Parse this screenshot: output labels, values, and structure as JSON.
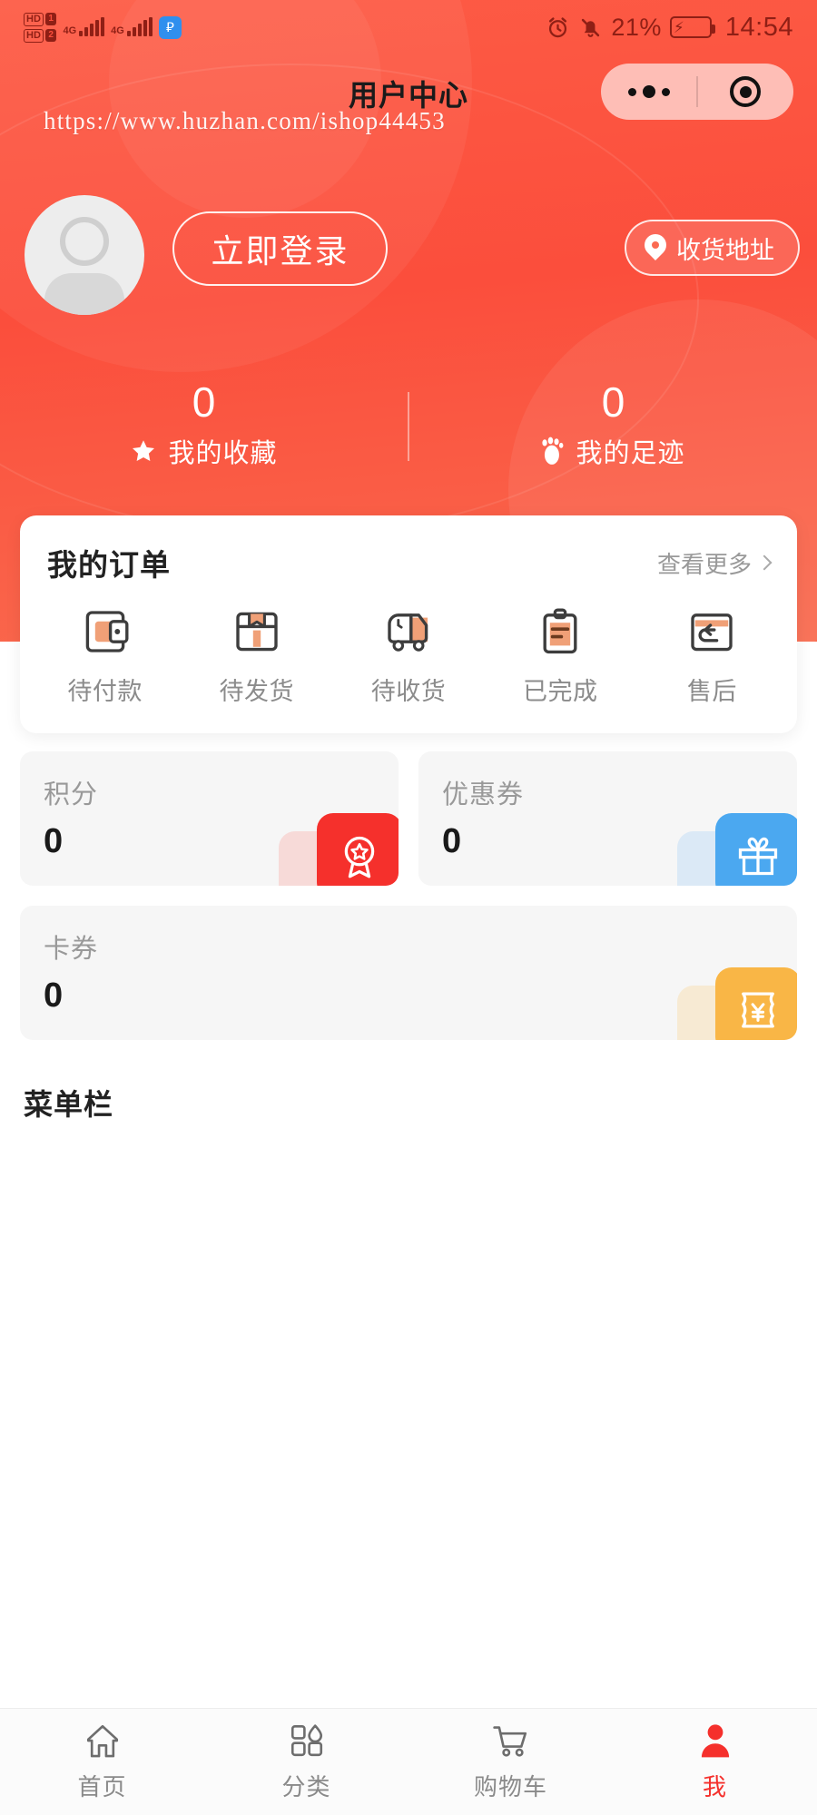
{
  "status_bar": {
    "hd1": "HD",
    "hd1_num": "1",
    "hd2": "HD",
    "hd2_num": "2",
    "net1": "4G",
    "net2": "4G",
    "bluetooth_icon": "bluetooth-icon",
    "alarm_icon": "alarm-icon",
    "mute_icon": "bell-muted-icon",
    "battery_percent": "21%",
    "battery_icon": "battery-charging-icon",
    "time": "14:54"
  },
  "navbar": {
    "title": "用户中心",
    "capsule": {
      "menu_icon": "more-dots-icon",
      "target_icon": "target-circle-icon"
    }
  },
  "watermark": "https://www.huzhan.com/ishop44453",
  "profile": {
    "avatar_icon": "default-avatar-icon",
    "login_label": "立即登录",
    "address_label": "收货地址",
    "address_icon": "location-pin-icon"
  },
  "stats": [
    {
      "value": "0",
      "label": "我的收藏",
      "icon": "star-icon"
    },
    {
      "value": "0",
      "label": "我的足迹",
      "icon": "footprint-icon"
    }
  ],
  "orders": {
    "title": "我的订单",
    "more_label": "查看更多",
    "more_icon": "chevron-right-icon",
    "items": [
      {
        "label": "待付款",
        "icon": "wallet-icon"
      },
      {
        "label": "待发货",
        "icon": "package-icon"
      },
      {
        "label": "待收货",
        "icon": "truck-icon"
      },
      {
        "label": "已完成",
        "icon": "clipboard-icon"
      },
      {
        "label": "售后",
        "icon": "return-icon"
      }
    ]
  },
  "assets": [
    {
      "title": "积分",
      "value": "0",
      "icon": "medal-icon",
      "color": "#F5302C",
      "ghost": "#FBAEA9"
    },
    {
      "title": "优惠券",
      "value": "0",
      "icon": "gift-icon",
      "color": "#4BA8F0",
      "ghost": "#AFD6F7"
    },
    {
      "title": "卡券",
      "value": "0",
      "icon": "ticket-yuan-icon",
      "color": "#F9B646",
      "ghost": "#FBD79C"
    }
  ],
  "menu_section": {
    "title": "菜单栏"
  },
  "tabbar": [
    {
      "label": "首页",
      "icon": "home-icon",
      "active": false
    },
    {
      "label": "分类",
      "icon": "category-icon",
      "active": false
    },
    {
      "label": "购物车",
      "icon": "cart-icon",
      "active": false
    },
    {
      "label": "我",
      "icon": "user-icon",
      "active": true
    }
  ],
  "theme": {
    "primary": "#FB4E3C",
    "primary_light": "#FD6B52",
    "active": "#F5302C",
    "card_bg": "#F6F6F6"
  }
}
